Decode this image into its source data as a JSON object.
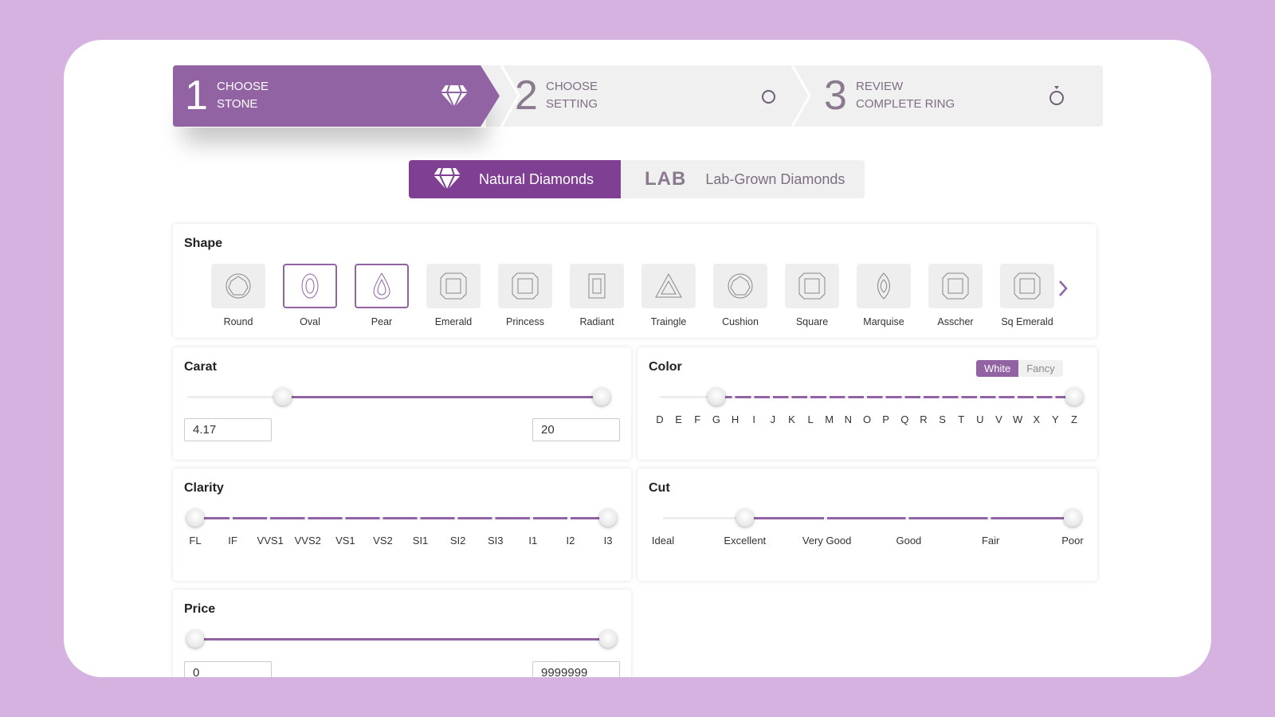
{
  "steps": [
    {
      "num": "1",
      "line1": "Choose",
      "line2": "Stone",
      "icon": "diamond-icon",
      "active": true
    },
    {
      "num": "2",
      "line1": "Choose",
      "line2": "Setting",
      "icon": "ring-circle-icon"
    },
    {
      "num": "3",
      "line1": "Review",
      "line2": "Complete Ring",
      "icon": "ring-icon"
    }
  ],
  "toggle": {
    "natural": "Natural Diamonds",
    "lab_logo": "LAB",
    "lab": "Lab-Grown Diamonds",
    "selected": "Natural Diamonds"
  },
  "shape": {
    "title": "Shape",
    "items": [
      "Round",
      "Oval",
      "Pear",
      "Emerald",
      "Princess",
      "Radiant",
      "Traingle",
      "Cushion",
      "Square",
      "Marquise",
      "Asscher",
      "Sq Emerald"
    ],
    "selected": [
      "Oval",
      "Pear"
    ]
  },
  "carat": {
    "title": "Carat",
    "min": "4.17",
    "max": "20",
    "low_fraction": 0.23,
    "high_fraction": 1
  },
  "color": {
    "title": "Color",
    "tabs": [
      "White",
      "Fancy"
    ],
    "active_tab": "White",
    "grades": [
      "D",
      "E",
      "F",
      "G",
      "H",
      "I",
      "J",
      "K",
      "L",
      "M",
      "N",
      "O",
      "P",
      "Q",
      "R",
      "S",
      "T",
      "U",
      "V",
      "W",
      "X",
      "Y",
      "Z"
    ],
    "from": "G",
    "to": "Z"
  },
  "clarity": {
    "title": "Clarity",
    "grades": [
      "FL",
      "IF",
      "VVS1",
      "VVS2",
      "VS1",
      "VS2",
      "SI1",
      "SI2",
      "SI3",
      "I1",
      "I2",
      "I3"
    ],
    "from": "FL",
    "to": "I3"
  },
  "cut": {
    "title": "Cut",
    "grades": [
      "Ideal",
      "Excellent",
      "Very Good",
      "Good",
      "Fair",
      "Poor"
    ],
    "from": "Excellent",
    "to": "Poor"
  },
  "price": {
    "title": "Price",
    "min": "0",
    "max": "9999999"
  },
  "colors": {
    "accent": "#9163a3",
    "dark_accent": "#7f3f93",
    "background": "#d5b2e0"
  }
}
